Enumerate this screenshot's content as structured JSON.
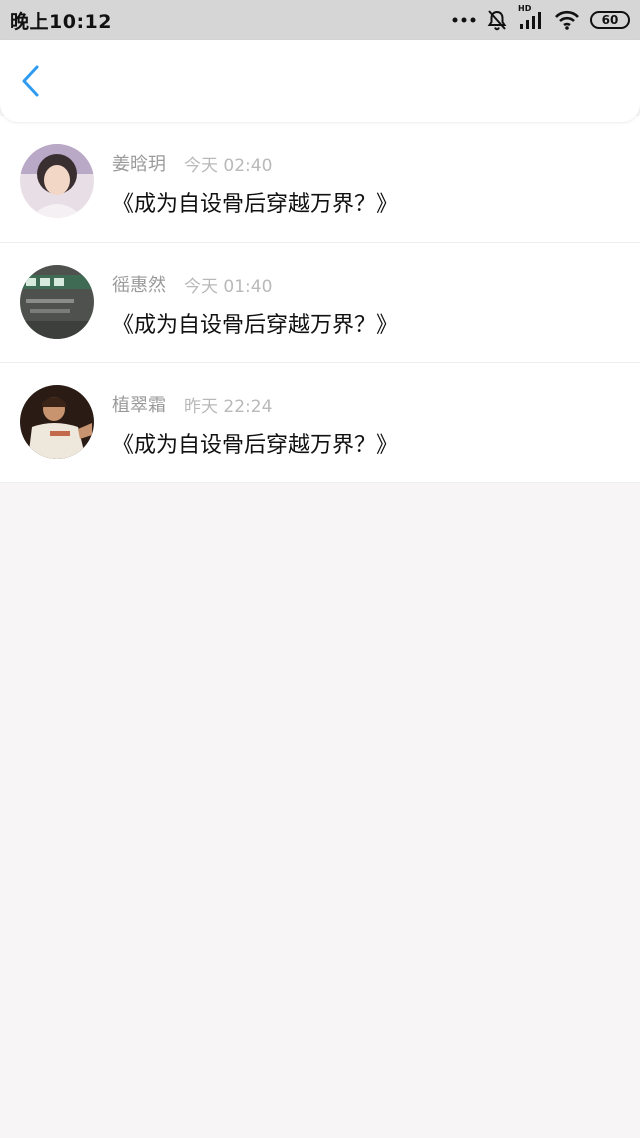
{
  "status_bar": {
    "time": "晚上10:12",
    "signal_label": "HD",
    "battery": "60"
  },
  "header": {
    "back_icon": "chevron-left-icon",
    "accent_color": "#2e9bf0"
  },
  "messages": [
    {
      "name": "姜晗玥",
      "time": "今天 02:40",
      "text": "《成为自设骨后穿越万界？》",
      "avatar": "avatar-photo-1"
    },
    {
      "name": "徭惠然",
      "time": "今天 01:40",
      "text": "《成为自设骨后穿越万界？》",
      "avatar": "avatar-photo-2"
    },
    {
      "name": "植翠霜",
      "time": "昨天 22:24",
      "text": "《成为自设骨后穿越万界？》",
      "avatar": "avatar-photo-3"
    }
  ]
}
